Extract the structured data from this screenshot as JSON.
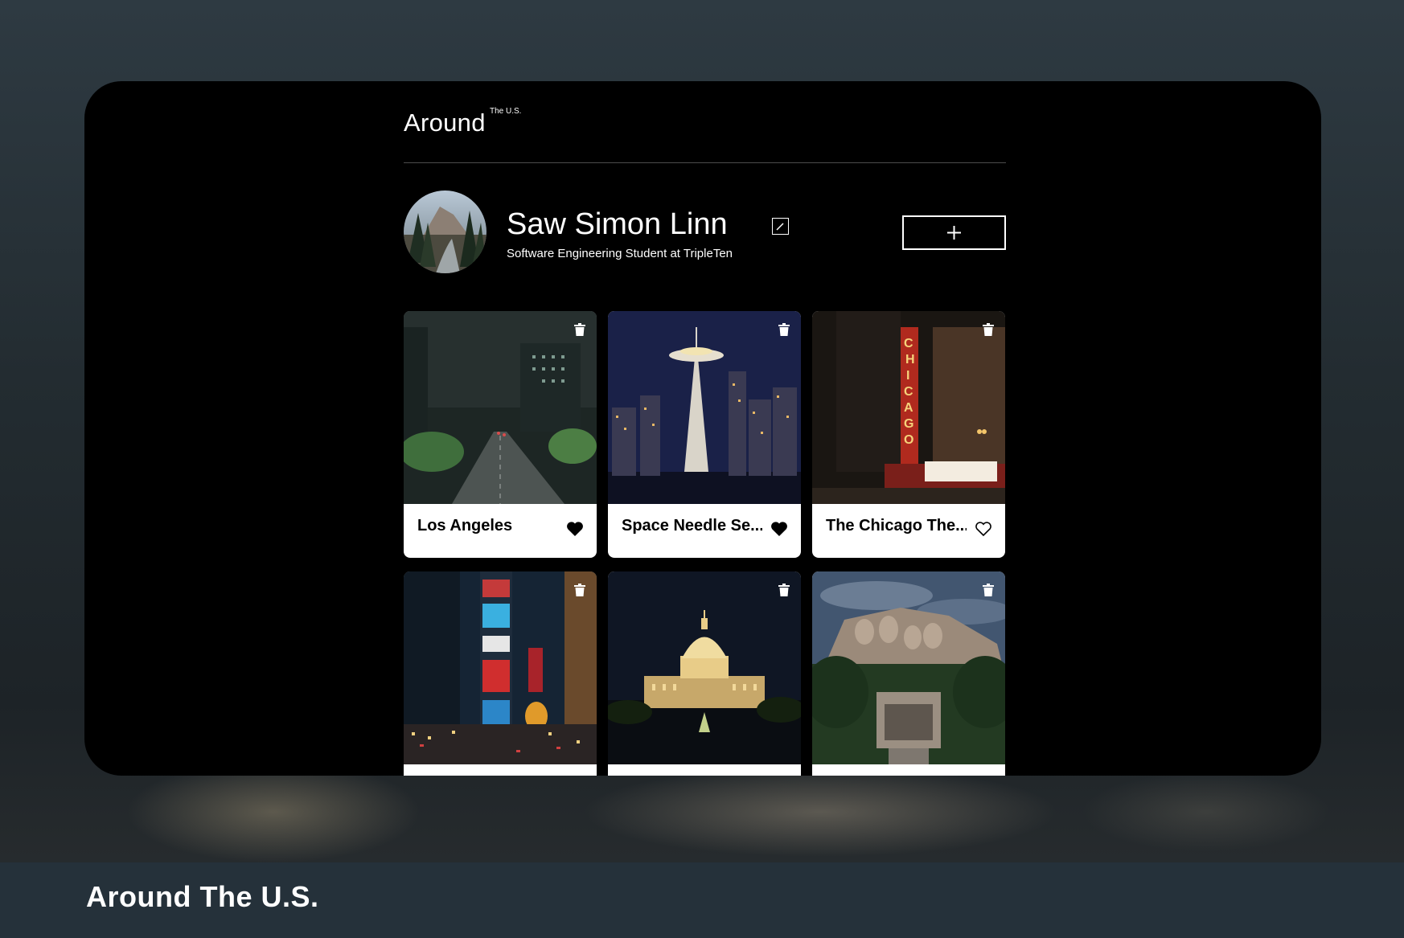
{
  "header": {
    "logo_main": "Around",
    "logo_sup": "The U.S."
  },
  "profile": {
    "name": "Saw Simon Linn",
    "description": "Software Engineering Student at TripleTen",
    "avatar_icon": "forest-avatar"
  },
  "cards": [
    {
      "title": "Los Angeles",
      "liked": true
    },
    {
      "title": "Space Needle Se...",
      "liked": true
    },
    {
      "title": "The Chicago The...",
      "liked": false
    },
    {
      "title": "",
      "liked": false
    },
    {
      "title": "",
      "liked": false
    },
    {
      "title": "",
      "liked": false
    }
  ],
  "caption": "Around The U.S.",
  "colors": {
    "page_background": "#000000",
    "card_background": "#ffffff",
    "caption_bar": "#25313a"
  }
}
